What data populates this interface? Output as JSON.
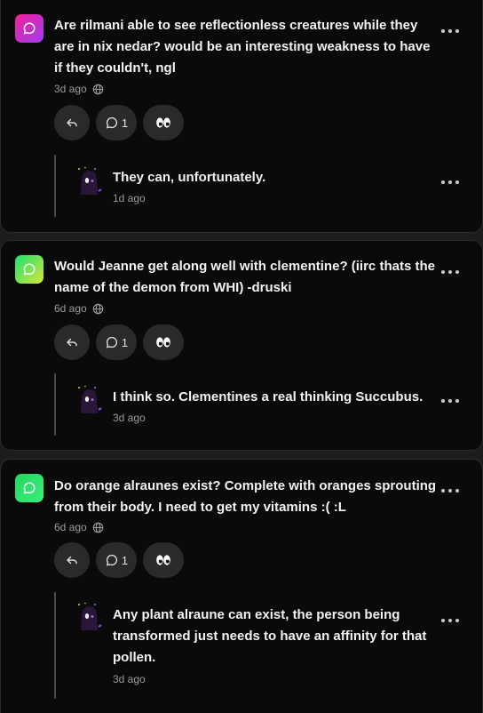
{
  "posts": [
    {
      "icon_name": "ask-bubble-icon",
      "icon_gradient": [
        "#f0209a",
        "#a03cf0"
      ],
      "question": "Are rilmani able to see reflectionless creatures while they are in nix nedar? would be an interesting weakness to have if they couldn't, ngl",
      "time": "3d ago",
      "comment_count": "1",
      "answer": "They can, unfortunately.",
      "answer_time": "1d ago"
    },
    {
      "icon_name": "ask-bubble-icon",
      "icon_gradient": [
        "#18e070",
        "#d6e838"
      ],
      "question": "Would Jeanne get along well with clementine? (iirc thats the name of the demon from WHI) -druski",
      "time": "6d ago",
      "comment_count": "1",
      "answer": "I think so. Clementines a real thinking Succubus.",
      "answer_time": "3d ago"
    },
    {
      "icon_name": "ask-bubble-icon",
      "icon_gradient": [
        "#22d65e",
        "#3af07a"
      ],
      "question": "Do orange alraunes exist? Complete with oranges sprouting from their body. I need to get my vitamins :( :L",
      "time": "6d ago",
      "comment_count": "1",
      "answer": "Any plant alraune can exist, the person being transformed just needs to have an affinity for that pollen.",
      "answer_time": "3d ago"
    }
  ]
}
